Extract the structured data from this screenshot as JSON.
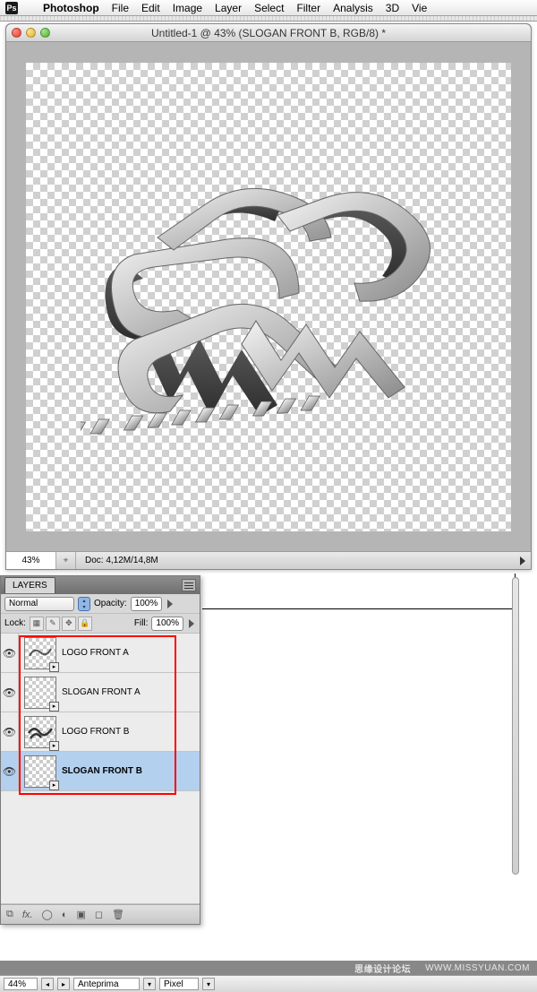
{
  "menubar": {
    "app_badge": "Ps",
    "apple_glyph": "",
    "app_name": "Photoshop",
    "items": [
      "File",
      "Edit",
      "Image",
      "Layer",
      "Select",
      "Filter",
      "Analysis",
      "3D",
      "Vie"
    ]
  },
  "document": {
    "title": "Untitled-1 @ 43% (SLOGAN FRONT B, RGB/8) *",
    "zoom": "43%",
    "doc_info": "Doc: 4,12M/14,8M"
  },
  "layers_panel": {
    "tab": "LAYERS",
    "blend_mode": "Normal",
    "opacity_label": "Opacity:",
    "opacity_value": "100%",
    "lock_label": "Lock:",
    "fill_label": "Fill:",
    "fill_value": "100%",
    "layers": [
      {
        "name": "LOGO FRONT A",
        "selected": false
      },
      {
        "name": "SLOGAN FRONT A",
        "selected": false
      },
      {
        "name": "LOGO FRONT B",
        "selected": false
      },
      {
        "name": "SLOGAN FRONT B",
        "selected": true
      }
    ],
    "footer_icons": [
      "link",
      "fx",
      "mask",
      "adjust",
      "group",
      "new",
      "trash"
    ]
  },
  "page_footer": {
    "cn_text": "思缘设计论坛",
    "url_text": "WWW.MISSYUAN.COM"
  },
  "app_status": {
    "zoom": "44%",
    "view": "Anteprima",
    "unit": "Pixel"
  },
  "icons": {
    "eye": "👁",
    "link": "⧉",
    "fx": "fx.",
    "mask": "◯",
    "adjust": "◐",
    "group": "▣",
    "new": "◻",
    "trash": "🗑",
    "smart": "▸",
    "nav": "⌖",
    "up": "▴",
    "down": "▾",
    "left": "◂",
    "right": "▸"
  }
}
